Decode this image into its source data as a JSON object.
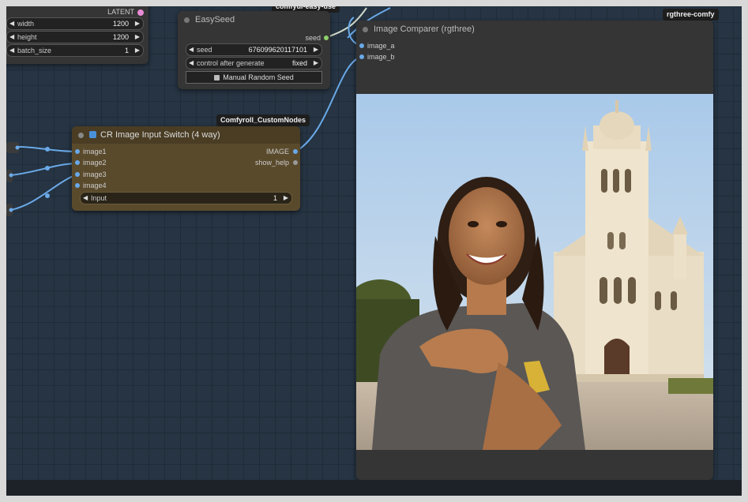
{
  "latent_node": {
    "output_label": "LATENT",
    "widgets": [
      {
        "label": "width",
        "value": "1200"
      },
      {
        "label": "height",
        "value": "1200"
      },
      {
        "label": "batch_size",
        "value": "1"
      }
    ]
  },
  "easyseed": {
    "title": "EasySeed",
    "badge": "comfyui-easy-use",
    "output_label": "seed",
    "seed_label": "seed",
    "seed_value": "676099620117101",
    "control_label": "control after generate",
    "control_value": "fixed",
    "button_label": "Manual Random Seed"
  },
  "switch_node": {
    "badge": "Comfyroll_CustomNodes",
    "title": "CR Image Input Switch (4 way)",
    "inputs": [
      "image1",
      "image2",
      "image3",
      "image4"
    ],
    "outputs": [
      "IMAGE",
      "show_help"
    ],
    "input_widget_label": "Input",
    "input_widget_value": "1",
    "colors": {
      "body": "#5a4a2c",
      "title": "#4a3d24"
    }
  },
  "comparer": {
    "badge": "rgthree-comfy",
    "title": "Image Comparer (rgthree)",
    "inputs": [
      "image_a",
      "image_b"
    ]
  },
  "colors": {
    "canvas": "#263443",
    "wire": "#6aa9e8",
    "wire_seed": "#8fd16a",
    "slot_image": "#6aa9e8",
    "slot_latent": "#e98bd6"
  }
}
